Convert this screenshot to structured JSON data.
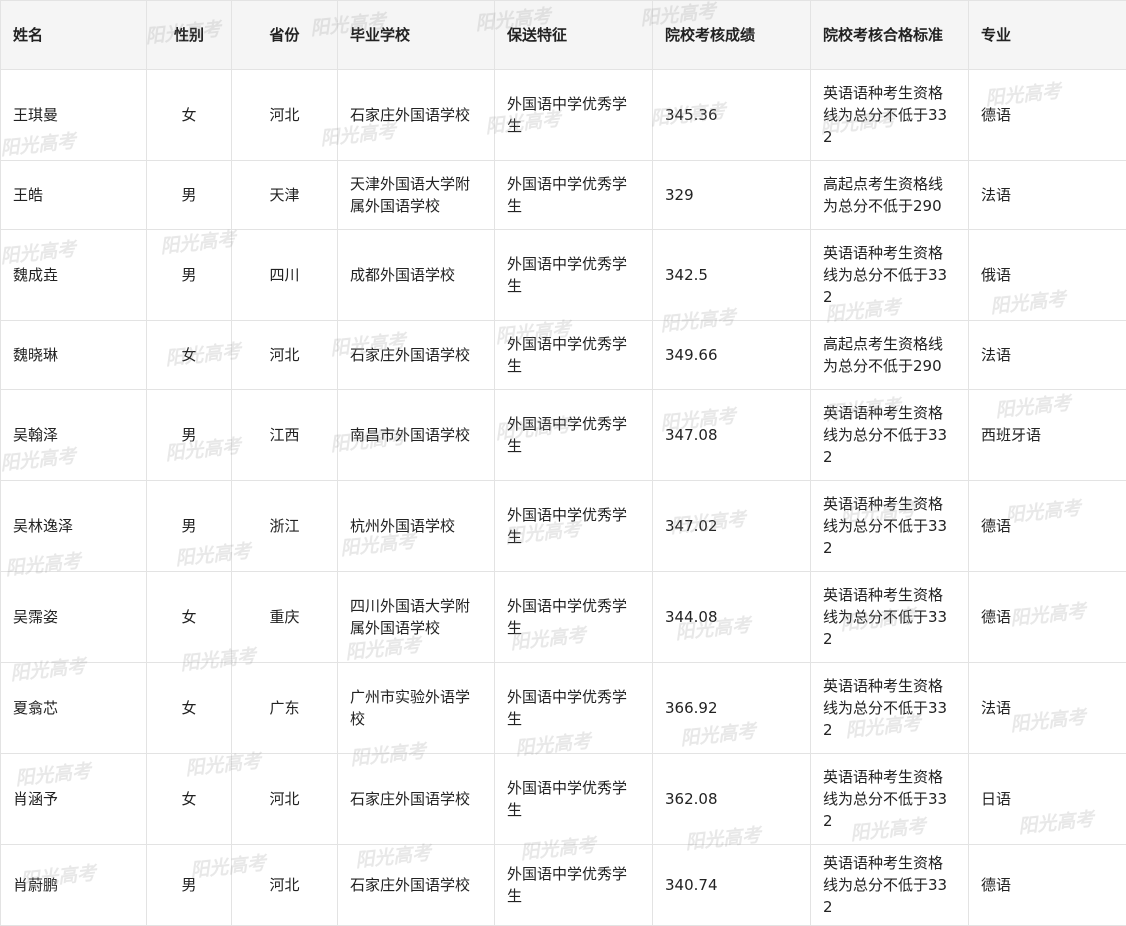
{
  "headers": [
    "姓名",
    "性别",
    "省份",
    "毕业学校",
    "保送特征",
    "院校考核成绩",
    "院校考核合格标准",
    "专业"
  ],
  "rows": [
    [
      "王琪曼",
      "女",
      "河北",
      "石家庄外国语学校",
      "外国语中学优秀学生",
      "345.36",
      "英语语种考生资格线为总分不低于332",
      "德语"
    ],
    [
      "王皓",
      "男",
      "天津",
      "天津外国语大学附属外国语学校",
      "外国语中学优秀学生",
      "329",
      "高起点考生资格线为总分不低于290",
      "法语"
    ],
    [
      "魏成垚",
      "男",
      "四川",
      "成都外国语学校",
      "外国语中学优秀学生",
      "342.5",
      "英语语种考生资格线为总分不低于332",
      "俄语"
    ],
    [
      "魏晓琳",
      "女",
      "河北",
      "石家庄外国语学校",
      "外国语中学优秀学生",
      "349.66",
      "高起点考生资格线为总分不低于290",
      "法语"
    ],
    [
      "吴翰泽",
      "男",
      "江西",
      "南昌市外国语学校",
      "外国语中学优秀学生",
      "347.08",
      "英语语种考生资格线为总分不低于332",
      "西班牙语"
    ],
    [
      "吴林逸泽",
      "男",
      "浙江",
      "杭州外国语学校",
      "外国语中学优秀学生",
      "347.02",
      "英语语种考生资格线为总分不低于332",
      "德语"
    ],
    [
      "吴霈姿",
      "女",
      "重庆",
      "四川外国语大学附属外国语学校",
      "外国语中学优秀学生",
      "344.08",
      "英语语种考生资格线为总分不低于332",
      "德语"
    ],
    [
      "夏翕芯",
      "女",
      "广东",
      "广州市实验外语学校",
      "外国语中学优秀学生",
      "366.92",
      "英语语种考生资格线为总分不低于332",
      "法语"
    ],
    [
      "肖涵予",
      "女",
      "河北",
      "石家庄外国语学校",
      "外国语中学优秀学生",
      "362.08",
      "英语语种考生资格线为总分不低于332",
      "日语"
    ],
    [
      "肖蔚鹏",
      "男",
      "河北",
      "石家庄外国语学校",
      "外国语中学优秀学生",
      "340.74",
      "英语语种考生资格线为总分不低于332",
      "德语"
    ]
  ],
  "watermark": "阳光高考",
  "colors": {
    "header_bg": "#f5f5f5",
    "border": "#e3e3e3",
    "text": "#222222"
  }
}
